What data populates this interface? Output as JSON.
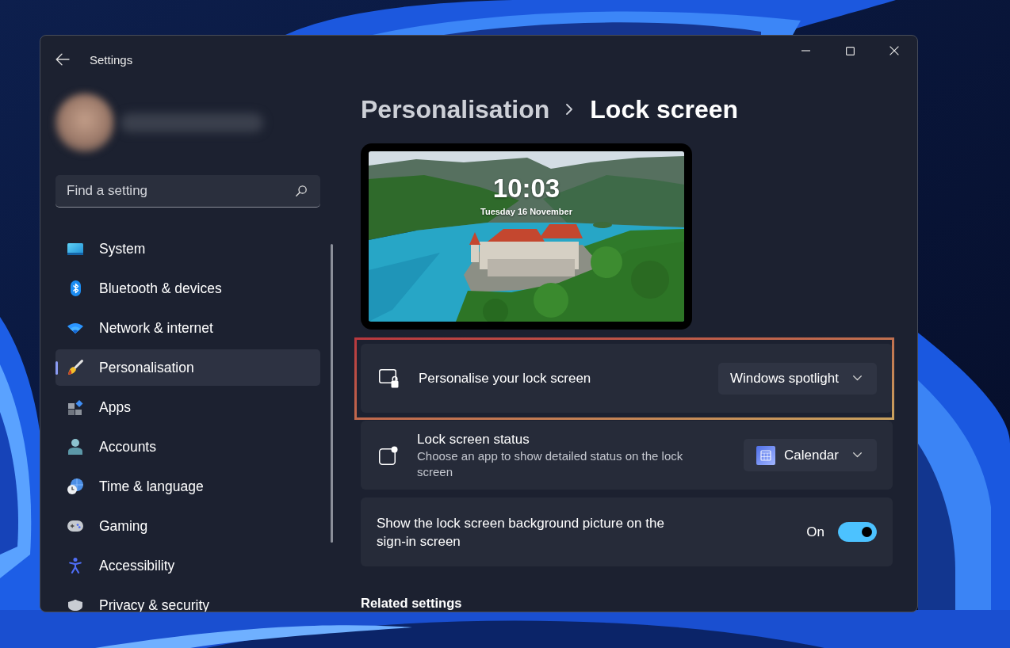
{
  "window": {
    "title": "Settings"
  },
  "sidebar": {
    "search": {
      "placeholder": "Find a setting"
    },
    "items": [
      {
        "label": "System",
        "selected": false
      },
      {
        "label": "Bluetooth & devices",
        "selected": false
      },
      {
        "label": "Network & internet",
        "selected": false
      },
      {
        "label": "Personalisation",
        "selected": true
      },
      {
        "label": "Apps",
        "selected": false
      },
      {
        "label": "Accounts",
        "selected": false
      },
      {
        "label": "Time & language",
        "selected": false
      },
      {
        "label": "Gaming",
        "selected": false
      },
      {
        "label": "Accessibility",
        "selected": false
      },
      {
        "label": "Privacy & security",
        "selected": false
      }
    ]
  },
  "breadcrumb": {
    "parent": "Personalisation",
    "current": "Lock screen"
  },
  "preview": {
    "time": "10:03",
    "date": "Tuesday 16 November"
  },
  "settings": [
    {
      "kind": "dropdown",
      "label": "Personalise your lock screen",
      "value": "Windows spotlight",
      "highlighted": true
    },
    {
      "kind": "dropdown",
      "label": "Lock screen status",
      "description": "Choose an app to show detailed status on the lock screen",
      "value": "Calendar",
      "highlighted": false
    },
    {
      "kind": "toggle",
      "label": "Show the lock screen background picture on the sign-in screen",
      "state_label": "On",
      "on": true,
      "highlighted": false
    }
  ],
  "related_settings": {
    "heading": "Related settings"
  }
}
